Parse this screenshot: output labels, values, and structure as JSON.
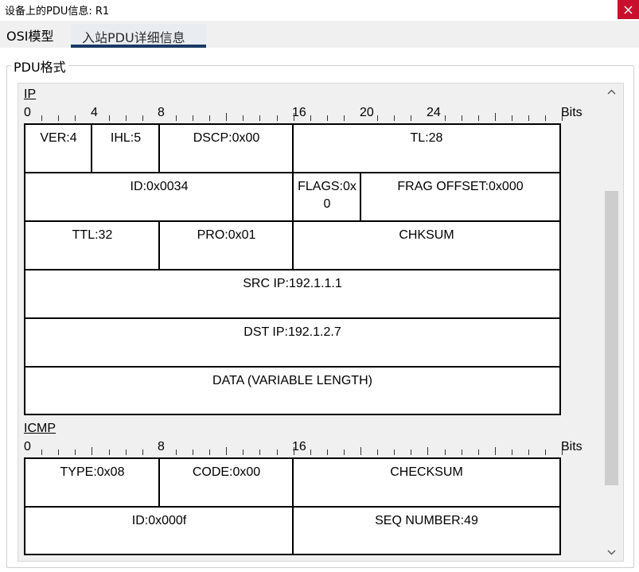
{
  "window": {
    "title": "设备上的PDU信息: R1"
  },
  "tabs": [
    {
      "label": "OSI模型"
    },
    {
      "label": "入站PDU详细信息"
    }
  ],
  "group": {
    "legend": "PDU格式"
  },
  "ip": {
    "label": "IP",
    "ruler": [
      "0",
      "4",
      "8",
      "16",
      "20",
      "24",
      "Bits"
    ],
    "fields": {
      "ver": "VER:4",
      "ihl": "IHL:5",
      "dscp": "DSCP:0x00",
      "tl": "TL:28",
      "id": "ID:0x0034",
      "flags": "FLAGS:0x0",
      "frag": "FRAG OFFSET:0x000",
      "ttl": "TTL:32",
      "pro": "PRO:0x01",
      "chksum": "CHKSUM",
      "src": "SRC IP:192.1.1.1",
      "dst": "DST IP:192.1.2.7",
      "data": "DATA (VARIABLE LENGTH)"
    }
  },
  "icmp": {
    "label": "ICMP",
    "ruler": [
      "0",
      "8",
      "16",
      "Bits"
    ],
    "fields": {
      "type": "TYPE:0x08",
      "code": "CODE:0x00",
      "checksum": "CHECKSUM",
      "id": "ID:0x000f",
      "seq": "SEQ NUMBER:49"
    }
  }
}
